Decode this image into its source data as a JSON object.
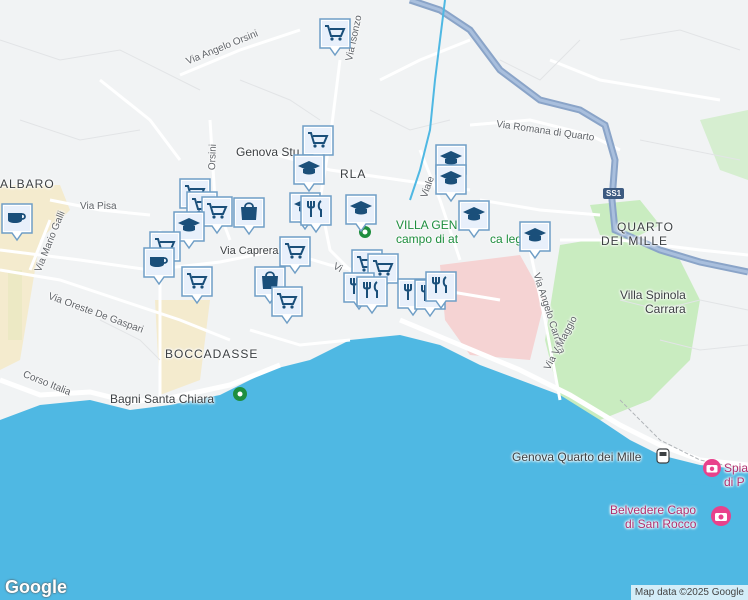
{
  "map": {
    "colors": {
      "land": "#f1f3f4",
      "sea": "#4fb8e3",
      "beach": "#f5e8c4",
      "park": "#c9ecc0",
      "hospital": "#f5d3d3",
      "highway": "#8aa4c8",
      "road": "#ffffff",
      "marker": "#1a4f7a"
    },
    "labels": {
      "albaro": "ALBARO",
      "quarto_dei_mille_1": "QUARTO",
      "quarto_dei_mille_2": "DEI MILLE",
      "boccadasse": "BOCCADASSE",
      "sturla_left": "Genova Stu",
      "sturla_right": "RLA",
      "villa_gentile_1": "VILLA GEN",
      "villa_gentile_2": "campo di at",
      "villa_gentile_3": "ca leg",
      "villa_spinola_1": "Villa Spinola",
      "villa_spinola_2": "Carrara",
      "bagni_santa_chiara": "Bagni Santa Chiara",
      "genova_quarto_station": "Genova Quarto dei Mille",
      "belvedere_1": "Belvedere Capo",
      "belvedere_2": "di San Rocco",
      "spia_1": "Spia",
      "spia_2": "di P"
    },
    "streets": {
      "via_angelo_orsini": "Via Angelo Orsini",
      "via_isonzo": "Via Isonzo",
      "via_orsini": "Orsini",
      "via_pisa": "Via Pisa",
      "via_mario_galli": "Via Mario Galli",
      "via_caprera": "Via Caprera",
      "via_oreste_de_gaspari": "Via Oreste De Gaspari",
      "corso_italia": "Corso Italia",
      "via_romana_di_quarto": "Via Romana di Quarto",
      "viale": "Viale",
      "via_angelo_carrara": "Via Angelo Carrara",
      "via_v_maggio": "Via V Maggio",
      "via_v_fragment": "Vi"
    },
    "road_shield": "SS1",
    "google_logo": "Google",
    "attribution": "Map data ©2025 Google",
    "markers": [
      {
        "icon": "cart"
      },
      {
        "icon": "cart"
      },
      {
        "icon": "school"
      },
      {
        "icon": "school"
      },
      {
        "icon": "cart"
      },
      {
        "icon": "cart"
      },
      {
        "icon": "cart"
      },
      {
        "icon": "bag"
      },
      {
        "icon": "school"
      },
      {
        "icon": "coffee"
      },
      {
        "icon": "cart"
      },
      {
        "icon": "coffee"
      },
      {
        "icon": "cart"
      },
      {
        "icon": "cart"
      },
      {
        "icon": "bag"
      },
      {
        "icon": "cart"
      },
      {
        "icon": "restaurant"
      },
      {
        "icon": "school"
      },
      {
        "icon": "school"
      },
      {
        "icon": "school"
      },
      {
        "icon": "school"
      },
      {
        "icon": "school"
      },
      {
        "icon": "cart"
      },
      {
        "icon": "cart"
      },
      {
        "icon": "restaurant"
      },
      {
        "icon": "restaurant"
      },
      {
        "icon": "restaurant"
      },
      {
        "icon": "restaurant"
      },
      {
        "icon": "restaurant"
      }
    ]
  }
}
